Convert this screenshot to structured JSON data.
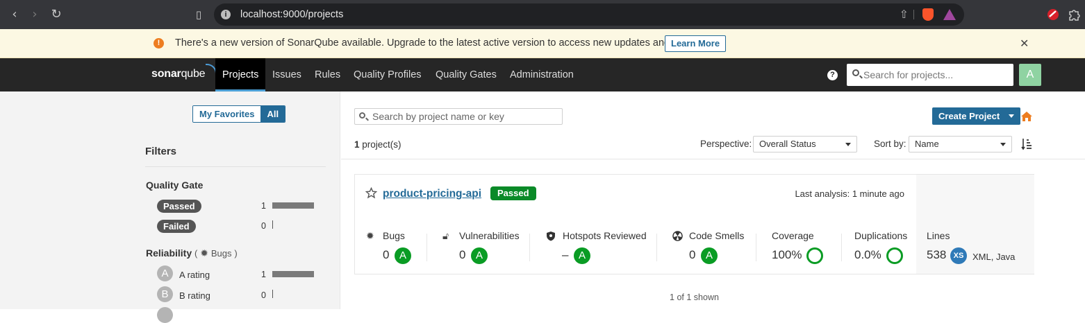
{
  "browser": {
    "url": "localhost:9000/projects"
  },
  "banner": {
    "message": "There's a new version of SonarQube available. Upgrade to the latest active version to access new updates and features.",
    "learn_more": "Learn More"
  },
  "nav": {
    "logo_bold": "sonar",
    "logo_rest": "qube",
    "items": [
      "Projects",
      "Issues",
      "Rules",
      "Quality Profiles",
      "Quality Gates",
      "Administration"
    ],
    "search_placeholder": "Search for projects...",
    "avatar_letter": "A"
  },
  "sidebar": {
    "my_favorites": "My Favorites",
    "all": "All",
    "filters_title": "Filters",
    "quality_gate": {
      "title": "Quality Gate",
      "options": [
        {
          "label": "Passed",
          "count": "1",
          "fraction": 1.0
        },
        {
          "label": "Failed",
          "count": "0",
          "fraction": 0.0
        }
      ]
    },
    "reliability": {
      "title": "Reliability",
      "paren_open": "(",
      "sub": "Bugs",
      "paren_close": ")",
      "options": [
        {
          "grade": "A",
          "label": "A rating",
          "count": "1",
          "fraction": 1.0
        },
        {
          "grade": "B",
          "label": "B rating",
          "count": "0",
          "fraction": 0.0
        }
      ]
    }
  },
  "main": {
    "search_placeholder": "Search by project name or key",
    "create_project": "Create Project",
    "project_count": "1",
    "project_count_suffix": "project(s)",
    "perspective_label": "Perspective:",
    "perspective_value": "Overall Status",
    "sort_label": "Sort by:",
    "sort_value": "Name",
    "shown": "1 of 1 shown"
  },
  "project": {
    "name": "product-pricing-api",
    "status": "Passed",
    "last_analysis": "Last analysis: 1 minute ago",
    "metrics": {
      "bugs": {
        "label": "Bugs",
        "value": "0",
        "grade": "A"
      },
      "vulnerabilities": {
        "label": "Vulnerabilities",
        "value": "0",
        "grade": "A"
      },
      "hotspots": {
        "label": "Hotspots Reviewed",
        "value": "–",
        "grade": "A"
      },
      "code_smells": {
        "label": "Code Smells",
        "value": "0",
        "grade": "A"
      },
      "coverage": {
        "label": "Coverage",
        "value": "100%"
      },
      "duplications": {
        "label": "Duplications",
        "value": "0.0%"
      },
      "lines": {
        "label": "Lines",
        "value": "538",
        "size": "XS",
        "languages": "XML, Java"
      }
    }
  },
  "colors": {
    "accent": "#236a97",
    "passed": "#0a8a28",
    "grade_a": "#0a9c24",
    "topnav": "#262626",
    "banner_bg": "#fcf8e3"
  }
}
